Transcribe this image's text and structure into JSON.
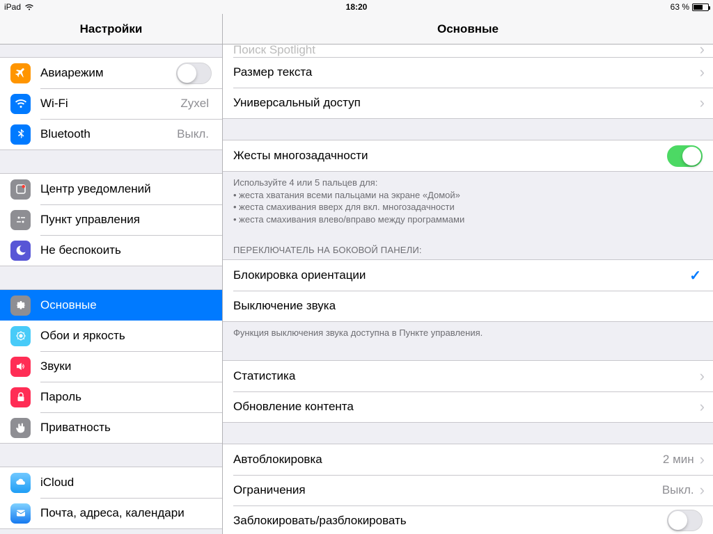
{
  "status": {
    "device": "iPad",
    "time": "18:20",
    "battery_text": "63 %"
  },
  "header": {
    "sidebar_title": "Настройки",
    "detail_title": "Основные"
  },
  "sidebar": {
    "groups": [
      {
        "items": [
          {
            "label": "Авиарежим",
            "toggle": false,
            "icon": "airplane"
          },
          {
            "label": "Wi-Fi",
            "value": "Zyxel",
            "icon": "wifi"
          },
          {
            "label": "Bluetooth",
            "value": "Выкл.",
            "icon": "bluetooth"
          }
        ]
      },
      {
        "items": [
          {
            "label": "Центр уведомлений",
            "icon": "notifications"
          },
          {
            "label": "Пункт управления",
            "icon": "control-center"
          },
          {
            "label": "Не беспокоить",
            "icon": "dnd"
          }
        ]
      },
      {
        "items": [
          {
            "label": "Основные",
            "icon": "general",
            "selected": true
          },
          {
            "label": "Обои и яркость",
            "icon": "wallpaper"
          },
          {
            "label": "Звуки",
            "icon": "sounds"
          },
          {
            "label": "Пароль",
            "icon": "passcode"
          },
          {
            "label": "Приватность",
            "icon": "privacy"
          }
        ]
      },
      {
        "items": [
          {
            "label": "iCloud",
            "icon": "icloud"
          },
          {
            "label": "Почта, адреса, календари",
            "icon": "mail"
          }
        ]
      }
    ]
  },
  "detail": {
    "cut_row_label": "Поиск Spotlight",
    "group_top": {
      "items": [
        {
          "label": "Размер текста"
        },
        {
          "label": "Универсальный доступ"
        }
      ]
    },
    "multitask": {
      "label": "Жесты многозадачности",
      "toggle": true,
      "footer_lead": "Используйте 4 или 5 пальцев для:",
      "footer_lines": [
        "жеста хватания всеми пальцами на экране «Домой»",
        "жеста смахивания вверх для вкл. многозадачности",
        "жеста смахивания влево/вправо между программами"
      ]
    },
    "side_switch": {
      "header": "ПЕРЕКЛЮЧАТЕЛЬ НА БОКОВОЙ ПАНЕЛИ:",
      "items": [
        {
          "label": "Блокировка ориентации",
          "checked": true
        },
        {
          "label": "Выключение звука",
          "checked": false
        }
      ],
      "footer": "Функция выключения звука доступна в Пункте управления."
    },
    "usage": {
      "items": [
        {
          "label": "Статистика"
        },
        {
          "label": "Обновление контента"
        }
      ]
    },
    "autolock": {
      "items": [
        {
          "label": "Автоблокировка",
          "value": "2 мин"
        },
        {
          "label": "Ограничения",
          "value": "Выкл."
        },
        {
          "label": "Заблокировать/разблокировать",
          "toggle": false
        }
      ]
    }
  }
}
